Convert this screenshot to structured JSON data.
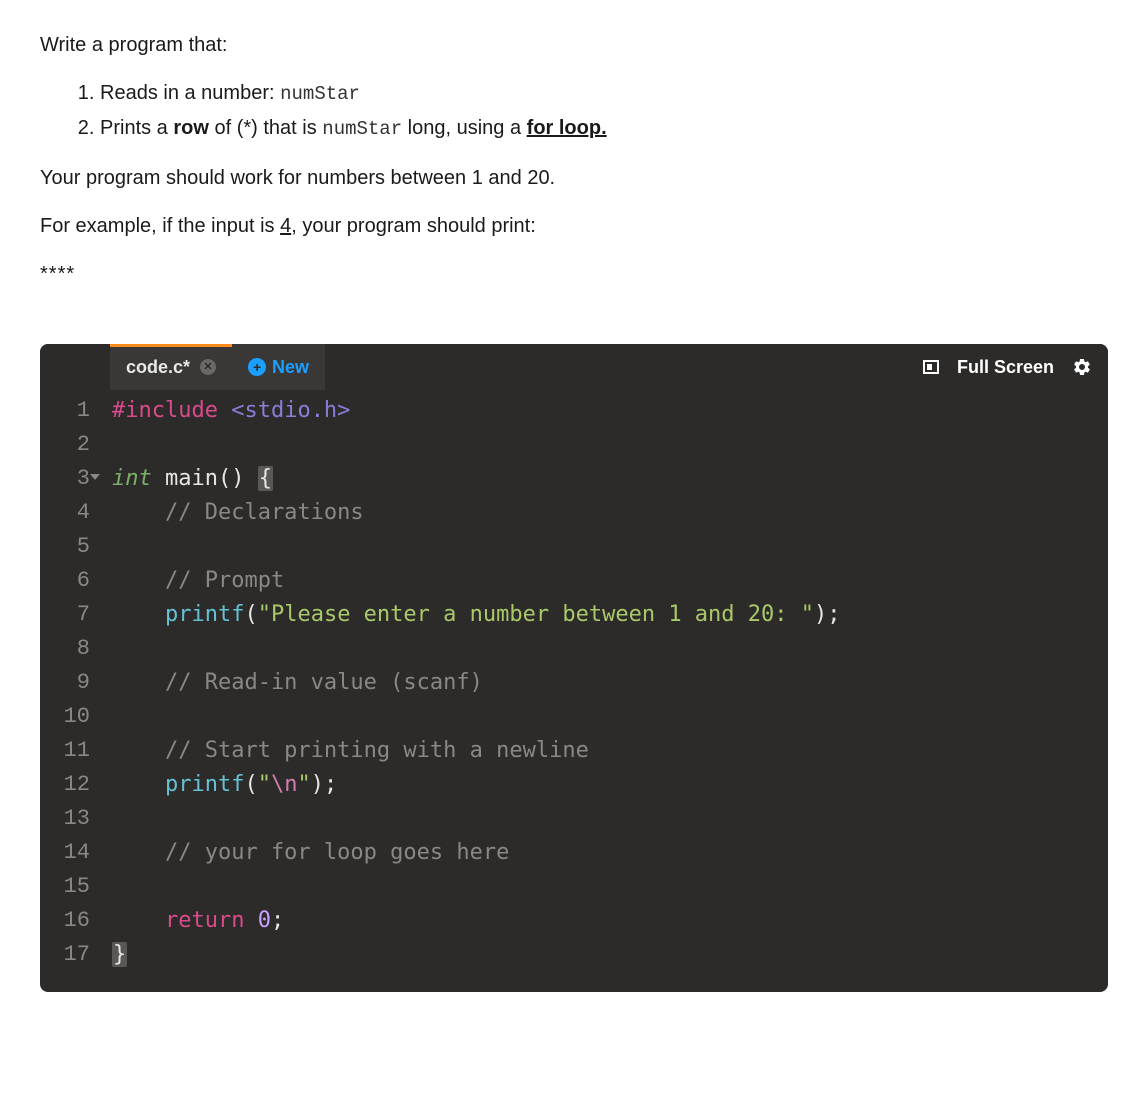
{
  "prompt": {
    "intro": "Write a program that:",
    "li1_a": "Reads in a number: ",
    "li1_code": "numStar",
    "li2_a": "Prints a ",
    "li2_bold": "row",
    "li2_b": " of (*) that is ",
    "li2_code": "numStar",
    "li2_c": " long, using a ",
    "li2_ul": "for loop.",
    "range": "Your program should work for numbers between 1 and 20.",
    "ex_a": "For example, if the input is ",
    "ex_u": "4",
    "ex_b": ", your program should print:",
    "stars": "****"
  },
  "tabs": {
    "active": "code.c*",
    "new": "New"
  },
  "toolbar": {
    "fullscreen": "Full Screen"
  },
  "code": {
    "line_count": 17,
    "l1_a": "#include",
    "l1_b": "<stdio.h>",
    "l3_a": "int",
    "l3_b": " main() ",
    "l3_c": "{",
    "l4": "    // Declarations",
    "l6": "    // Prompt",
    "l7_a": "    ",
    "l7_fn": "printf",
    "l7_p1": "(",
    "l7_str": "\"Please enter a number between 1 and 20: \"",
    "l7_p2": ");",
    "l9": "    // Read-in value (scanf)",
    "l11": "    // Start printing with a newline",
    "l12_a": "    ",
    "l12_fn": "printf",
    "l12_p1": "(",
    "l12_q1": "\"",
    "l12_esc": "\\n",
    "l12_q2": "\"",
    "l12_p2": ");",
    "l14": "    // your for loop goes here",
    "l16_a": "    ",
    "l16_kw": "return",
    "l16_sp": " ",
    "l16_num": "0",
    "l16_sc": ";",
    "l17": "}"
  }
}
